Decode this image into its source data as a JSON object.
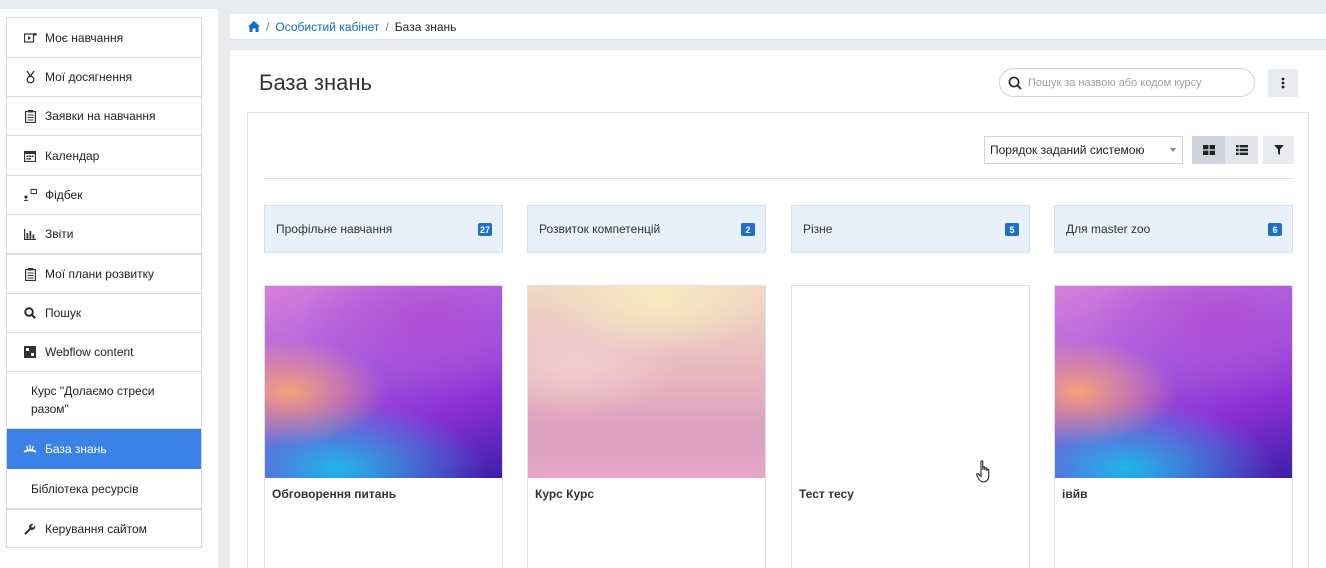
{
  "sidebar": {
    "items": [
      {
        "label": "Моє навчання",
        "icon": "my-learning-icon"
      },
      {
        "label": "Мої досягнення",
        "icon": "medal-icon"
      },
      {
        "label": "Заявки на навчання",
        "icon": "clipboard-icon"
      },
      {
        "label": "Календар",
        "icon": "calendar-icon"
      },
      {
        "label": "Фідбек",
        "icon": "feedback-icon"
      },
      {
        "label": "Звіти",
        "icon": "reports-icon"
      },
      {
        "label": "Мої плани розвитку",
        "icon": "clipboard-icon"
      },
      {
        "label": "Пошук",
        "icon": "search-icon"
      },
      {
        "label": "Webflow content",
        "icon": "webflow-icon"
      },
      {
        "label": "Курс \"Долаємо стреси разом\"",
        "icon": ""
      },
      {
        "label": "База знань",
        "icon": "knowledge-base-icon",
        "active": true
      },
      {
        "label": "Бібліотека ресурсів",
        "icon": ""
      },
      {
        "label": "Керування сайтом",
        "icon": "wrench-icon"
      }
    ]
  },
  "breadcrumb": {
    "home_icon": "home-icon",
    "items": [
      "Особистий кабінет",
      "База знань"
    ]
  },
  "page": {
    "title": "База знань",
    "search_placeholder": "Пошук за назвою або кодом курсу"
  },
  "toolbar": {
    "sort_value": "Порядок заданий системою"
  },
  "categories": [
    {
      "label": "Профільне навчання",
      "count": "27"
    },
    {
      "label": "Розвиток компетенцій",
      "count": "2"
    },
    {
      "label": "Різне",
      "count": "5"
    },
    {
      "label": "Для master zoo",
      "count": "6"
    }
  ],
  "courses": [
    {
      "title": "Обговорення питань"
    },
    {
      "title": "Курс Курс"
    },
    {
      "title": "Тест тесу"
    },
    {
      "title": "івйв"
    }
  ],
  "colors": {
    "accent": "#3b82e6",
    "badge": "#1f6fc8",
    "category_bg": "#e8f0f9"
  }
}
